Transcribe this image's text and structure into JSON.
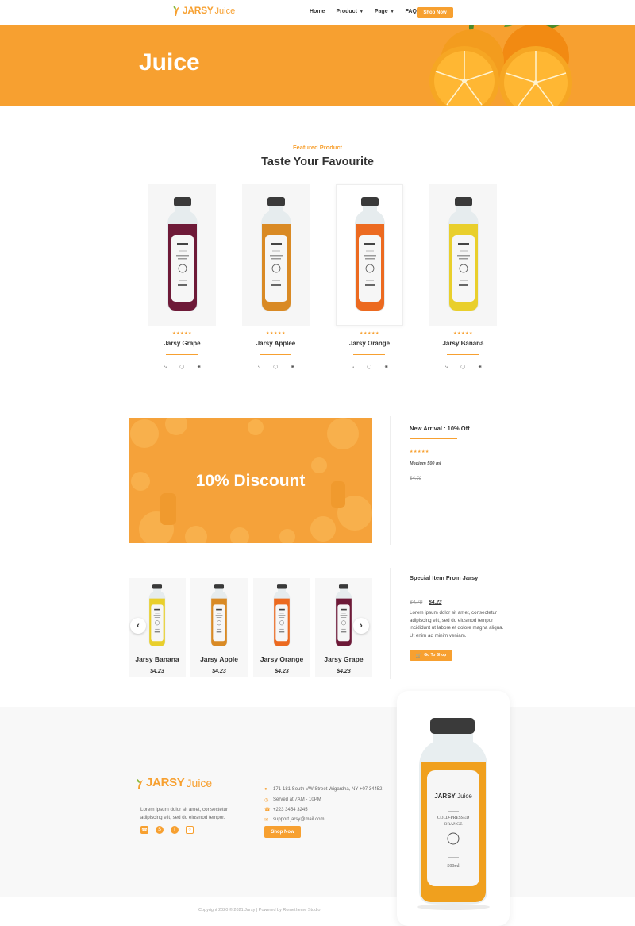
{
  "header": {
    "logo_brand": "JARSY",
    "logo_sub": "Juice",
    "nav": [
      {
        "label": "Home",
        "dropdown": false
      },
      {
        "label": "Product",
        "dropdown": true
      },
      {
        "label": "Page",
        "dropdown": true
      },
      {
        "label": "FAQ",
        "dropdown": false
      }
    ],
    "cta": "Shop Now"
  },
  "hero": {
    "title": "Juice"
  },
  "featured": {
    "eyebrow": "Featured Product",
    "title": "Taste Your Favourite",
    "products": [
      {
        "name": "Jarsy Grape",
        "color": "#6e1a38",
        "stars": "★★★★★"
      },
      {
        "name": "Jarsy Applee",
        "color": "#d98a25",
        "stars": "★★★★★"
      },
      {
        "name": "Jarsy Orange",
        "color": "#ec6a20",
        "stars": "★★★★★"
      },
      {
        "name": "Jarsy Banana",
        "color": "#e9cf2c",
        "stars": "★★★★★"
      }
    ],
    "social_icons": [
      "share-icon",
      "whatsapp-icon",
      "instagram-icon"
    ]
  },
  "discount": {
    "banner_text": "10% Discount",
    "side_title": "New Arrival : 10% Off",
    "stars": "★★★★★",
    "size": "Medium 500 ml",
    "old_price": "$4.70"
  },
  "bottle_label": {
    "brand": "JARSY",
    "sub": "Juice",
    "line1": "COLD-PRESSED",
    "line2": "ORANGE",
    "volume": "500ml"
  },
  "carousel": {
    "items": [
      {
        "name": "Jarsy Banana",
        "price": "$4.23",
        "color": "#e9cf2c"
      },
      {
        "name": "Jarsy Apple",
        "price": "$4.23",
        "color": "#d98a25"
      },
      {
        "name": "Jarsy Orange",
        "price": "$4.23",
        "color": "#ec6a20"
      },
      {
        "name": "Jarsy Grape",
        "price": "$4.23",
        "color": "#6e1a38"
      }
    ],
    "prev": "‹",
    "next": "›"
  },
  "special": {
    "title": "Special Item From Jarsy",
    "old_price": "$4.70",
    "new_price": "$4.23",
    "description": "Lorem ipsum dolor sit amet, consectetur adipiscing elit, sed do eiusmod tempor incididunt ut labore et dolore magna aliqua. Ut enim ad minim veniam.",
    "cta": "Go To Shop"
  },
  "footer": {
    "logo_brand": "JARSY",
    "logo_sub": "Juice",
    "about": "Lorem ipsum dolor sit amet, consectetur adipiscing elit, sed do eiusmod tempor.",
    "contacts": [
      {
        "icon": "map-pin-icon",
        "text": "171-181 South VW Street Wigardha, NY +07 34452"
      },
      {
        "icon": "clock-icon",
        "text": "Served at 7AM - 10PM"
      },
      {
        "icon": "phone-icon",
        "text": "+223 3454 3245"
      },
      {
        "icon": "mail-icon",
        "text": "support.jarsy@mail.com"
      }
    ],
    "cta": "Shop Now",
    "copyright": "Copyright 2020 © 2021 Jarsy | Powered by Rometheme Studio"
  },
  "colors": {
    "accent": "#f7a030"
  }
}
